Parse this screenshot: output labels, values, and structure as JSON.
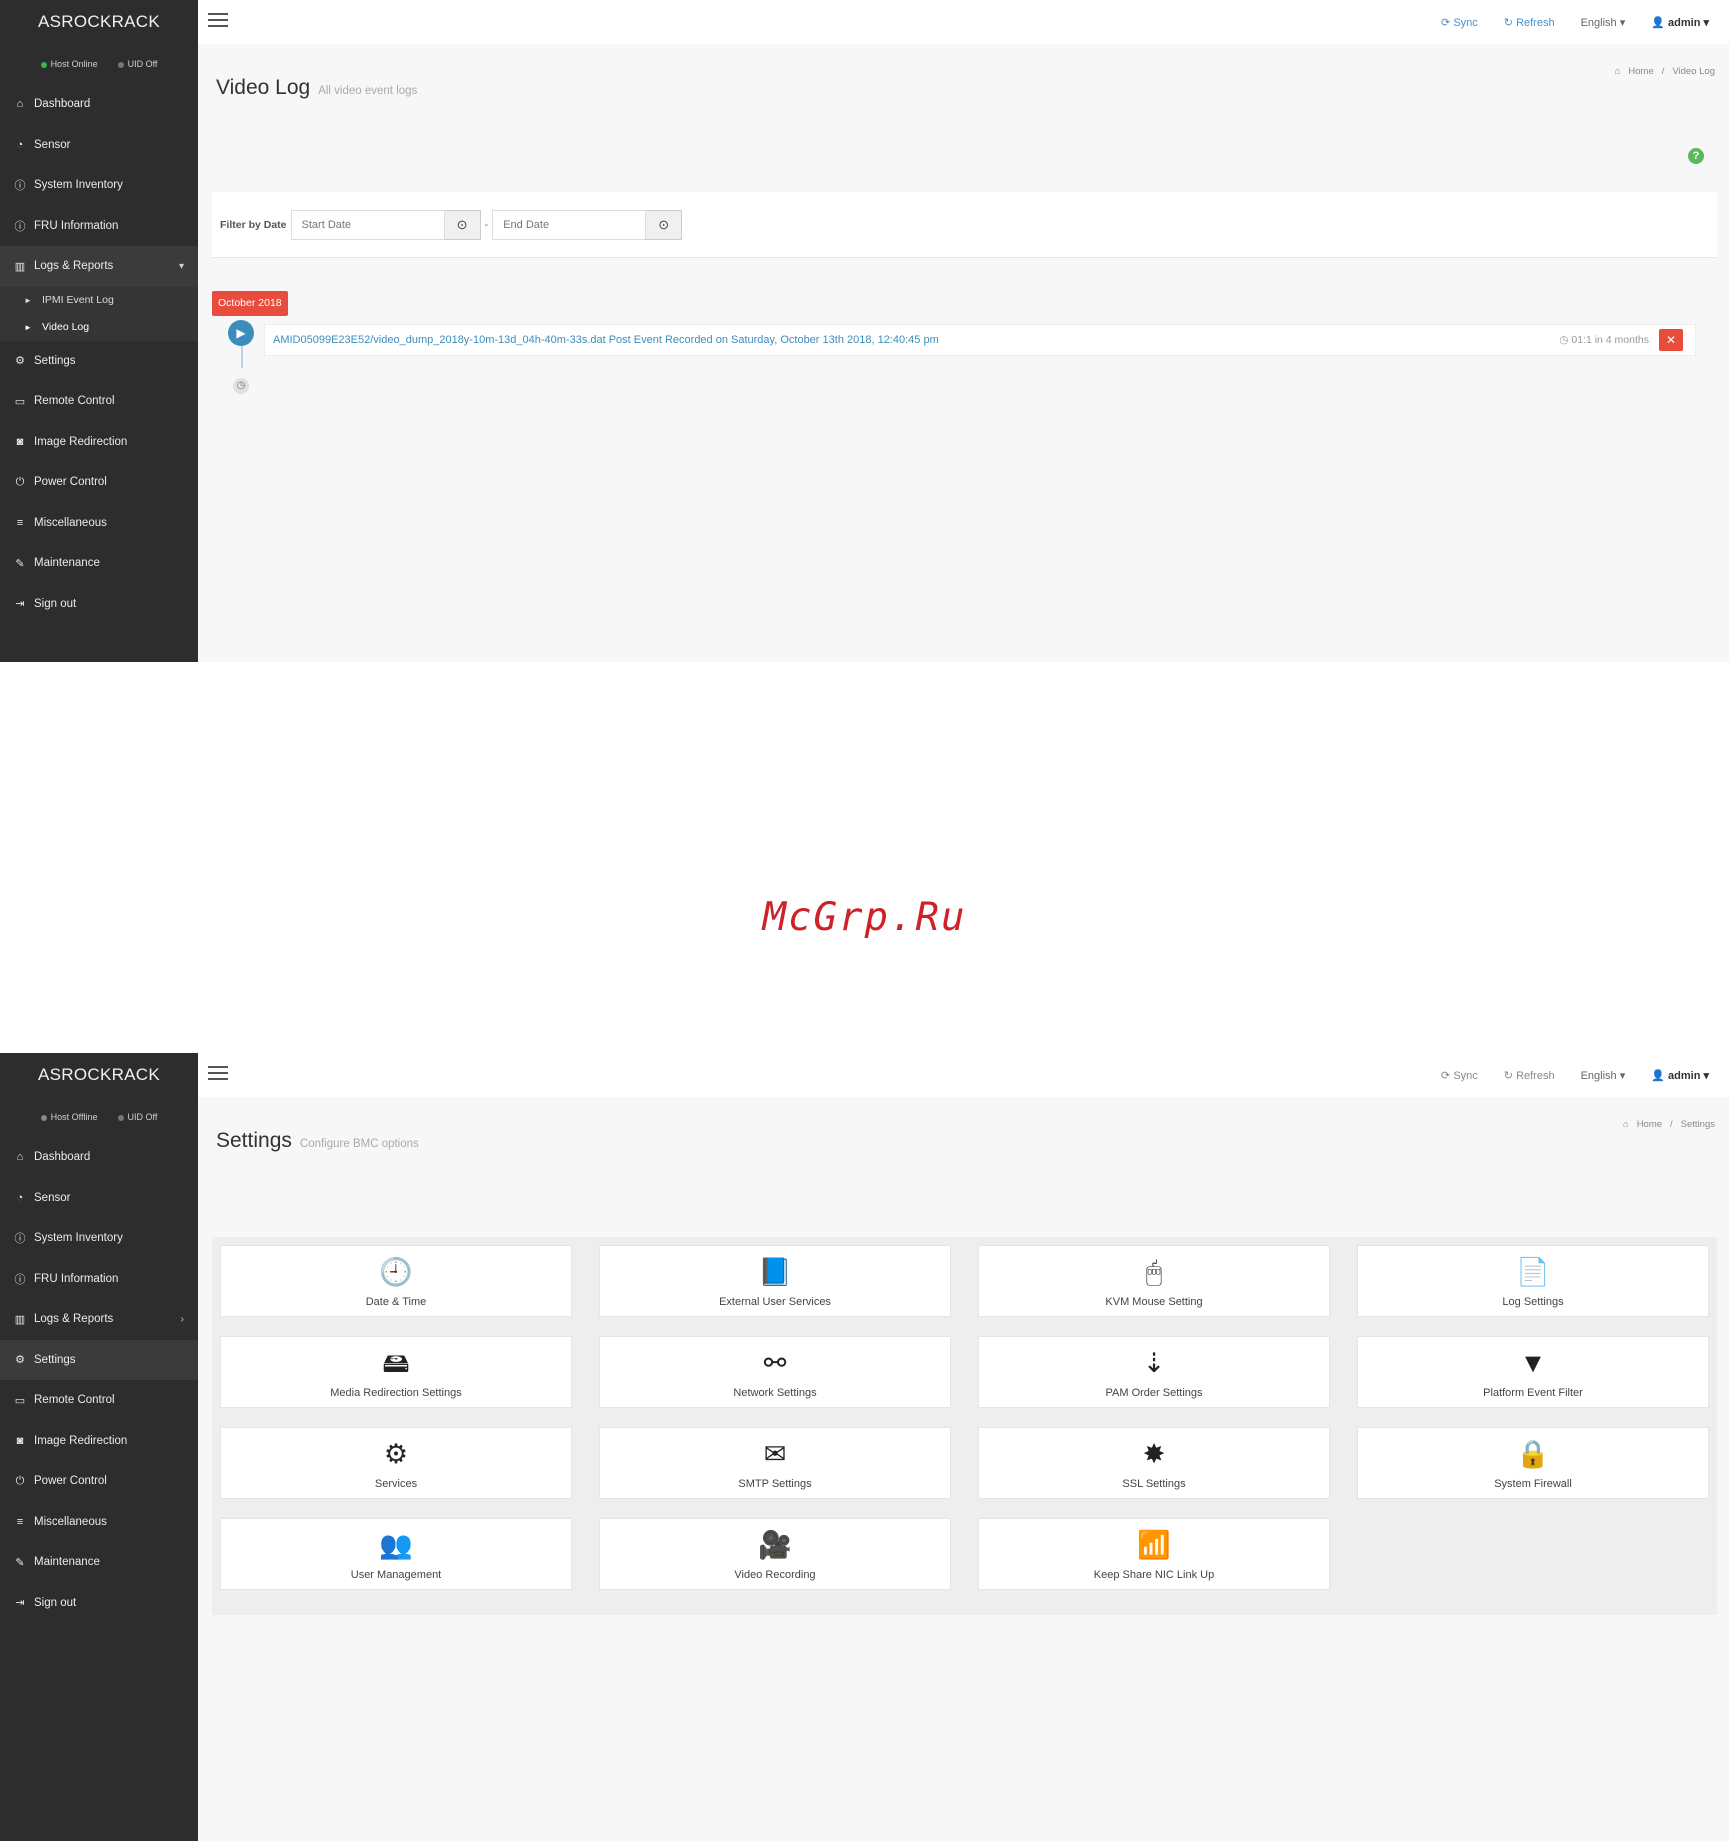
{
  "brand": "ASROCKRACK",
  "watermark": "McGrp.Ru",
  "shot1": {
    "status": {
      "host": "Host Online",
      "uid": "UID Off"
    },
    "topbar": {
      "sync": "Sync",
      "refresh": "Refresh",
      "language": "English",
      "user": "admin"
    },
    "page": {
      "title": "Video Log",
      "subtitle": "All video event logs",
      "crumb_home": "Home",
      "crumb_current": "Video Log"
    },
    "filter": {
      "label": "Filter by Date",
      "start_placeholder": "Start Date",
      "end_placeholder": "End Date",
      "separator": "-"
    },
    "timeline": {
      "badge": "October 2018",
      "item_text": "AMID05099E23E52/video_dump_2018y-10m-13d_04h-40m-33s.dat Post Event Recorded on Saturday, October 13th 2018, 12:40:45 pm",
      "item_time": "01:1 in 4 months"
    },
    "nav": [
      {
        "label": "Dashboard",
        "icon": "home-icon"
      },
      {
        "label": "Sensor",
        "icon": "dashboard-icon"
      },
      {
        "label": "System Inventory",
        "icon": "info-icon"
      },
      {
        "label": "FRU Information",
        "icon": "info-icon"
      },
      {
        "label": "Logs & Reports",
        "icon": "chart-icon"
      },
      {
        "label": "IPMI Event Log",
        "icon": "caret-right-icon"
      },
      {
        "label": "Video Log",
        "icon": "caret-right-icon"
      },
      {
        "label": "Settings",
        "icon": "gear-icon"
      },
      {
        "label": "Remote Control",
        "icon": "monitor-icon"
      },
      {
        "label": "Image Redirection",
        "icon": "disk-icon"
      },
      {
        "label": "Power Control",
        "icon": "power-icon"
      },
      {
        "label": "Miscellaneous",
        "icon": "list-icon"
      },
      {
        "label": "Maintenance",
        "icon": "wrench-icon"
      },
      {
        "label": "Sign out",
        "icon": "signout-icon"
      }
    ]
  },
  "shot2": {
    "status": {
      "host": "Host Offline",
      "uid": "UID Off"
    },
    "topbar": {
      "sync": "Sync",
      "refresh": "Refresh",
      "language": "English",
      "user": "admin"
    },
    "page": {
      "title": "Settings",
      "subtitle": "Configure BMC options",
      "crumb_home": "Home",
      "crumb_current": "Settings"
    },
    "nav": [
      {
        "label": "Dashboard",
        "icon": "home-icon"
      },
      {
        "label": "Sensor",
        "icon": "dashboard-icon"
      },
      {
        "label": "System Inventory",
        "icon": "info-icon"
      },
      {
        "label": "FRU Information",
        "icon": "info-icon"
      },
      {
        "label": "Logs & Reports",
        "icon": "chart-icon"
      },
      {
        "label": "Settings",
        "icon": "gear-icon"
      },
      {
        "label": "Remote Control",
        "icon": "monitor-icon"
      },
      {
        "label": "Image Redirection",
        "icon": "disk-icon"
      },
      {
        "label": "Power Control",
        "icon": "power-icon"
      },
      {
        "label": "Miscellaneous",
        "icon": "list-icon"
      },
      {
        "label": "Maintenance",
        "icon": "wrench-icon"
      },
      {
        "label": "Sign out",
        "icon": "signout-icon"
      }
    ],
    "tiles": [
      {
        "label": "Date & Time",
        "icon": "clock-icon"
      },
      {
        "label": "External User Services",
        "icon": "book-icon"
      },
      {
        "label": "KVM Mouse Setting",
        "icon": "mouse-icon"
      },
      {
        "label": "Log Settings",
        "icon": "file-icon"
      },
      {
        "label": "Media Redirection Settings",
        "icon": "hdd-icon"
      },
      {
        "label": "Network Settings",
        "icon": "sitemap-icon"
      },
      {
        "label": "PAM Order Settings",
        "icon": "sort-icon"
      },
      {
        "label": "Platform Event Filter",
        "icon": "filter-icon"
      },
      {
        "label": "Services",
        "icon": "cogs-icon"
      },
      {
        "label": "SMTP Settings",
        "icon": "envelope-icon"
      },
      {
        "label": "SSL Settings",
        "icon": "certificate-icon"
      },
      {
        "label": "System Firewall",
        "icon": "lock-icon"
      },
      {
        "label": "User Management",
        "icon": "users-icon"
      },
      {
        "label": "Video Recording",
        "icon": "video-icon"
      },
      {
        "label": "Keep Share NIC Link Up",
        "icon": "rss-icon"
      }
    ]
  }
}
